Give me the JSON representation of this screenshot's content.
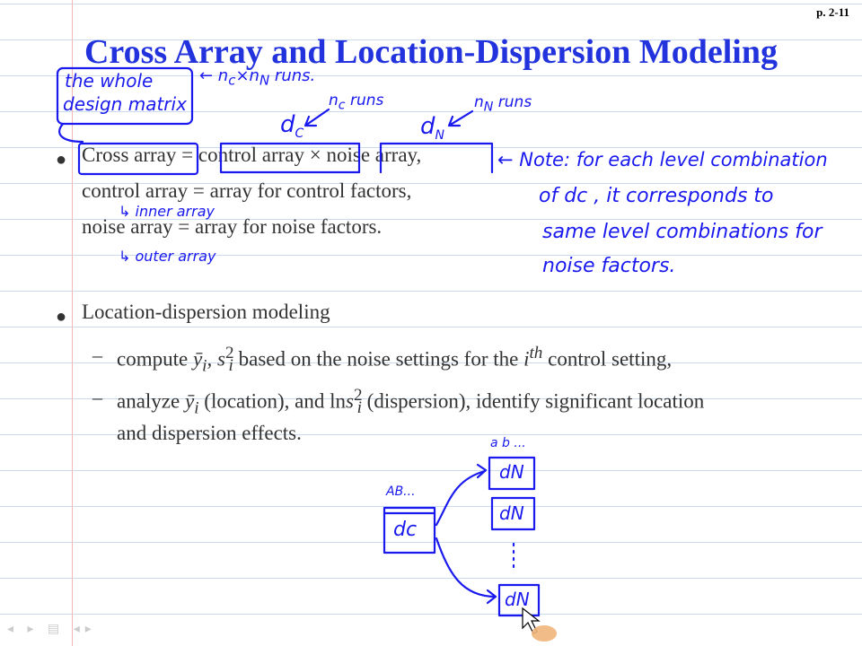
{
  "page": {
    "number": "p. 2-11"
  },
  "slide": {
    "title": "Cross Array and Location-Dispersion Modeling",
    "bullet1": {
      "cross_array": "Cross array",
      "equals": "=",
      "control_array": "control array",
      "times": "×",
      "noise_array": "noise array,",
      "line2": "control array = array for control factors,",
      "line3": "noise array = array for noise factors."
    },
    "bullet2": {
      "text": "Location-dispersion modeling",
      "sub1": {
        "pre": "compute",
        "ybar": "ȳ",
        "sub_i": "i",
        "s": ", s",
        "sup_2": "2",
        "sub_i2": "i",
        "post": "based on the noise settings for the",
        "ith_i": "i",
        "ith_th": "th",
        "tail": "control setting,"
      },
      "sub2": {
        "pre": "analyze",
        "ybar": "ȳ",
        "sub_i": "i",
        "mid": "(location), and ln",
        "s": "s",
        "sup_2": "2",
        "sub_i2": "i",
        "post": "(dispersion), identify significant location",
        "line2": "and dispersion effects."
      }
    }
  },
  "handwriting": {
    "whole_line1": "the whole",
    "whole_line2": "design matrix",
    "runs_total": "← n",
    "runs_total_sub1": "c",
    "runs_total_x": "×n",
    "runs_total_sub2": "N",
    "runs_total_tail": " runs.",
    "dc": "d",
    "dc_sub": "C",
    "nc_runs": "n",
    "nc_runs_sub": "c",
    "nc_runs_tail": " runs",
    "dn": "d",
    "dn_sub": "N",
    "nn_runs": "n",
    "nn_runs_sub": "N",
    "nn_runs_tail": " runs",
    "note1": "← Note: for each level combination",
    "note2": "of dc , it corresponds to",
    "note3": "same level combinations for",
    "note4": "noise factors.",
    "inner": "↳ inner array",
    "outer": "↳ outer array",
    "ab_upper": "AB...",
    "ab_lower": "a b ...",
    "box_dc": "dc",
    "box_dn1": "dN",
    "box_dn2": "dN",
    "box_dn3": "dN",
    "ellipsis": "⋮"
  },
  "nav": {
    "symbols": "◂ ▸ ▤ ◂▸"
  },
  "colors": {
    "title": "#2233dd",
    "ink": "#1a1aee",
    "text": "#333333"
  }
}
